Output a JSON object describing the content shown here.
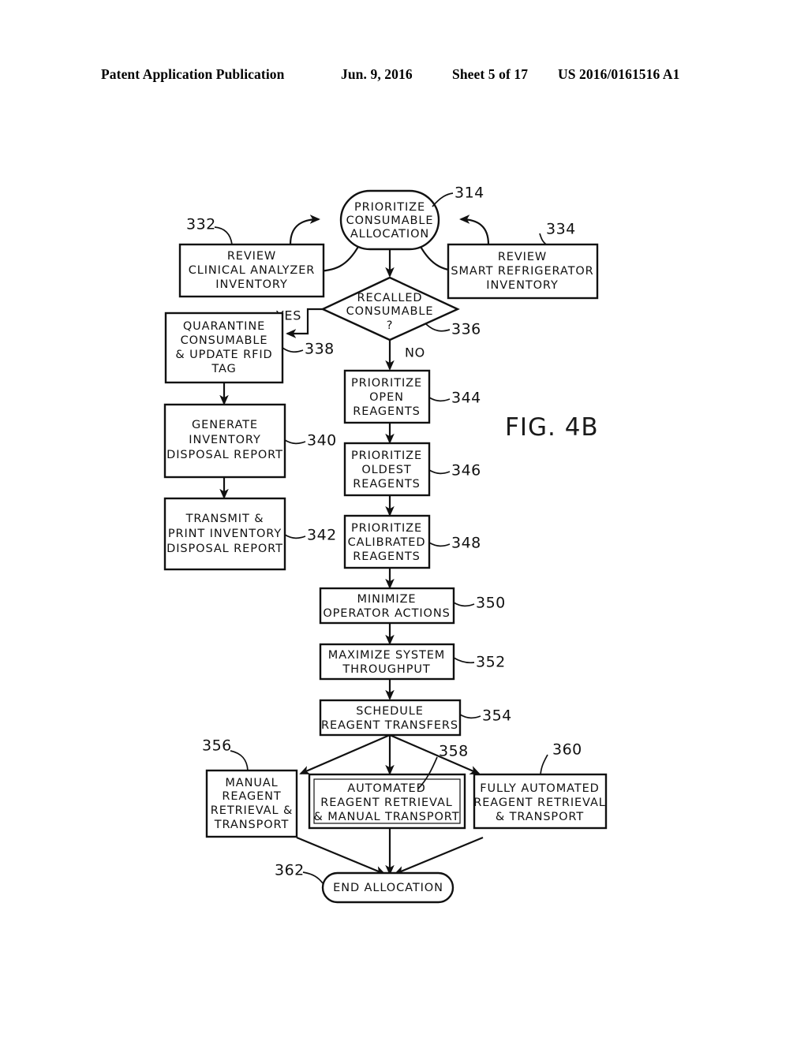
{
  "header": {
    "publication": "Patent Application Publication",
    "date": "Jun. 9, 2016",
    "sheet": "Sheet 5 of 17",
    "number": "US 2016/0161516 A1"
  },
  "figure": {
    "label": "FIG. 4B"
  },
  "diagram": {
    "type": "flowchart",
    "title": "FIG. 4B",
    "nodes": [
      {
        "id": "314",
        "ref": "314",
        "shape": "rounded-oval",
        "lines": [
          "PRIORITIZE",
          "CONSUMABLE",
          "ALLOCATION"
        ]
      },
      {
        "id": "332",
        "ref": "332",
        "shape": "rect",
        "lines": [
          "REVIEW",
          "CLINICAL ANALYZER",
          "INVENTORY"
        ]
      },
      {
        "id": "334",
        "ref": "334",
        "shape": "rect",
        "lines": [
          "REVIEW",
          "SMART REFRIGERATOR",
          "INVENTORY"
        ]
      },
      {
        "id": "336",
        "ref": "336",
        "shape": "diamond",
        "lines": [
          "RECALLED",
          "CONSUMABLE",
          "?"
        ]
      },
      {
        "id": "338",
        "ref": "338",
        "shape": "rect",
        "lines": [
          "QUARANTINE",
          "CONSUMABLE",
          "& UPDATE RFID",
          "TAG"
        ]
      },
      {
        "id": "340",
        "ref": "340",
        "shape": "rect",
        "lines": [
          "GENERATE",
          "INVENTORY",
          "DISPOSAL REPORT"
        ]
      },
      {
        "id": "342",
        "ref": "342",
        "shape": "rect",
        "lines": [
          "TRANSMIT &",
          "PRINT INVENTORY",
          "DISPOSAL REPORT"
        ]
      },
      {
        "id": "344",
        "ref": "344",
        "shape": "rect",
        "lines": [
          "PRIORITIZE",
          "OPEN",
          "REAGENTS"
        ]
      },
      {
        "id": "346",
        "ref": "346",
        "shape": "rect",
        "lines": [
          "PRIORITIZE",
          "OLDEST",
          "REAGENTS"
        ]
      },
      {
        "id": "348",
        "ref": "348",
        "shape": "rect",
        "lines": [
          "PRIORITIZE",
          "CALIBRATED",
          "REAGENTS"
        ]
      },
      {
        "id": "350",
        "ref": "350",
        "shape": "rect",
        "lines": [
          "MINIMIZE",
          "OPERATOR ACTIONS"
        ]
      },
      {
        "id": "352",
        "ref": "352",
        "shape": "rect",
        "lines": [
          "MAXIMIZE SYSTEM",
          "THROUGHPUT"
        ]
      },
      {
        "id": "354",
        "ref": "354",
        "shape": "rect",
        "lines": [
          "SCHEDULE",
          "REAGENT TRANSFERS"
        ]
      },
      {
        "id": "356",
        "ref": "356",
        "shape": "rect",
        "lines": [
          "MANUAL",
          "REAGENT",
          "RETRIEVAL &",
          "TRANSPORT"
        ]
      },
      {
        "id": "358",
        "ref": "358",
        "shape": "rect-double",
        "lines": [
          "AUTOMATED",
          "REAGENT RETRIEVAL",
          "& MANUAL TRANSPORT"
        ]
      },
      {
        "id": "360",
        "ref": "360",
        "shape": "rect",
        "lines": [
          "FULLY AUTOMATED",
          "REAGENT RETRIEVAL",
          "& TRANSPORT"
        ]
      },
      {
        "id": "362",
        "ref": "362",
        "shape": "stadium",
        "lines": [
          "END ALLOCATION"
        ]
      }
    ],
    "branch_labels": [
      {
        "id": "yes",
        "text": "YES"
      },
      {
        "id": "no",
        "text": "NO"
      }
    ],
    "edges": [
      {
        "from": "332",
        "to": "314"
      },
      {
        "from": "314",
        "to": "332"
      },
      {
        "from": "334",
        "to": "314"
      },
      {
        "from": "314",
        "to": "334"
      },
      {
        "from": "314",
        "to": "336"
      },
      {
        "from": "336",
        "to": "338",
        "label": "YES"
      },
      {
        "from": "336",
        "to": "344",
        "label": "NO"
      },
      {
        "from": "338",
        "to": "340"
      },
      {
        "from": "340",
        "to": "342"
      },
      {
        "from": "344",
        "to": "346"
      },
      {
        "from": "346",
        "to": "348"
      },
      {
        "from": "348",
        "to": "350"
      },
      {
        "from": "350",
        "to": "352"
      },
      {
        "from": "352",
        "to": "354"
      },
      {
        "from": "354",
        "to": "356"
      },
      {
        "from": "354",
        "to": "358"
      },
      {
        "from": "354",
        "to": "360"
      },
      {
        "from": "356",
        "to": "362"
      },
      {
        "from": "358",
        "to": "362"
      },
      {
        "from": "360",
        "to": "362"
      }
    ]
  }
}
